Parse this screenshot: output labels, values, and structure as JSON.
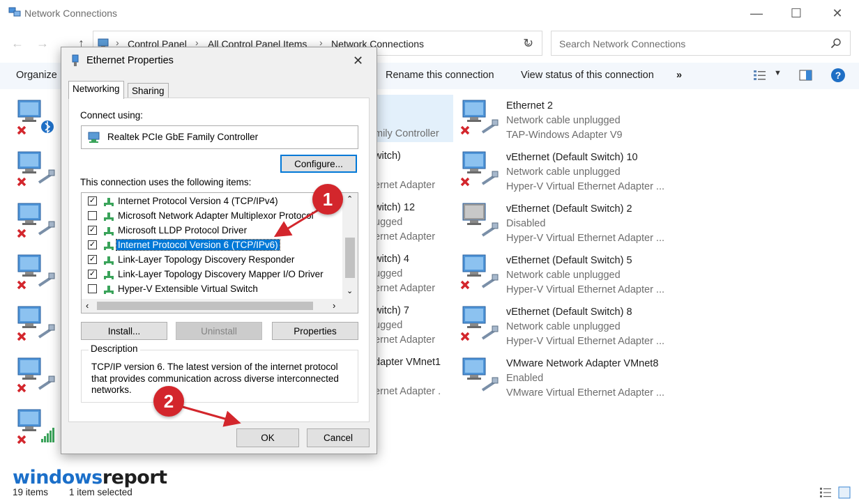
{
  "window": {
    "title": "Network Connections",
    "minimize": "—",
    "maximize": "☐",
    "close": "✕"
  },
  "address": {
    "crumbs": [
      "Control Panel",
      "All Control Panel Items",
      "Network Connections"
    ],
    "search_placeholder": "Search Network Connections"
  },
  "toolbar": {
    "organize": "Organize",
    "rename": "Rename this connection",
    "view_status": "View status of this connection",
    "more": "»"
  },
  "items_left_fragments": [
    {
      "text": "mily Controller"
    },
    {
      "text": "witch)"
    },
    {
      "text": "ernet Adapter"
    },
    {
      "text": "witch) 12"
    },
    {
      "text": "ugged"
    },
    {
      "text": "ernet Adapter"
    },
    {
      "text": "witch) 4"
    },
    {
      "text": "ugged"
    },
    {
      "text": "ernet Adapter"
    },
    {
      "text": "witch) 7"
    },
    {
      "text": "ugged"
    },
    {
      "text": "ernet Adapter"
    },
    {
      "text": "dapter VMnet1"
    },
    {
      "text": "ernet Adapter ."
    }
  ],
  "connections": [
    {
      "name": "Ethernet 2",
      "status": "Network cable unplugged",
      "device": "TAP-Windows Adapter V9"
    },
    {
      "name": "vEthernet (Default Switch) 10",
      "status": "Network cable unplugged",
      "device": "Hyper-V Virtual Ethernet Adapter ..."
    },
    {
      "name": "vEthernet (Default Switch) 2",
      "status": "Disabled",
      "device": "Hyper-V Virtual Ethernet Adapter ..."
    },
    {
      "name": "vEthernet (Default Switch) 5",
      "status": "Network cable unplugged",
      "device": "Hyper-V Virtual Ethernet Adapter ..."
    },
    {
      "name": "vEthernet (Default Switch) 8",
      "status": "Network cable unplugged",
      "device": "Hyper-V Virtual Ethernet Adapter ..."
    },
    {
      "name": "VMware Network Adapter VMnet8",
      "status": "Enabled",
      "device": "VMware Virtual Ethernet Adapter ..."
    }
  ],
  "statusbar": {
    "count": "19 items",
    "selected": "1 item selected"
  },
  "watermark": {
    "part1": "windows",
    "part2": "report"
  },
  "dialog": {
    "title": "Ethernet Properties",
    "close": "✕",
    "tabs": [
      "Networking",
      "Sharing"
    ],
    "connect_using_label": "Connect using:",
    "adapter": "Realtek PCIe GbE Family Controller",
    "configure": "Configure...",
    "items_label": "This connection uses the following items:",
    "items": [
      {
        "label": "Internet Protocol Version 4 (TCP/IPv4)",
        "checked": true
      },
      {
        "label": "Microsoft Network Adapter Multiplexor Protocol",
        "checked": false
      },
      {
        "label": "Microsoft LLDP Protocol Driver",
        "checked": true
      },
      {
        "label": "Internet Protocol Version 6 (TCP/IPv6)",
        "checked": true,
        "selected": true
      },
      {
        "label": "Link-Layer Topology Discovery Responder",
        "checked": true
      },
      {
        "label": "Link-Layer Topology Discovery Mapper I/O Driver",
        "checked": true
      },
      {
        "label": "Hyper-V Extensible Virtual Switch",
        "checked": false
      }
    ],
    "install": "Install...",
    "uninstall": "Uninstall",
    "properties": "Properties",
    "description_title": "Description",
    "description": "TCP/IP version 6. The latest version of the internet protocol that provides communication across diverse interconnected networks.",
    "ok": "OK",
    "cancel": "Cancel"
  },
  "annotations": {
    "step1": "1",
    "step2": "2",
    "accent": "#d3262c"
  }
}
